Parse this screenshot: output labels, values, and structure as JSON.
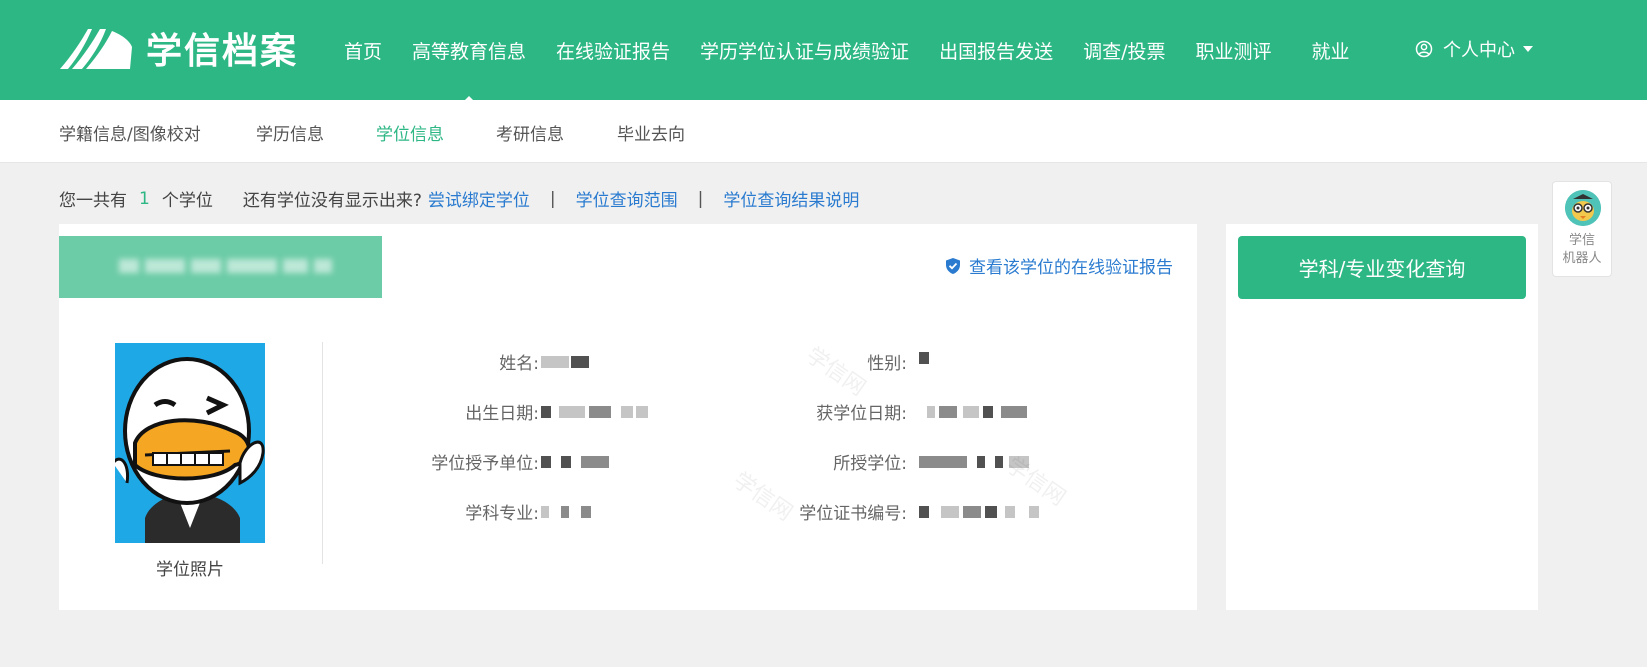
{
  "header": {
    "logo_text": "学信档案",
    "nav": [
      {
        "label": "首页"
      },
      {
        "label": "高等教育信息",
        "active": true
      },
      {
        "label": "在线验证报告"
      },
      {
        "label": "学历学位认证与成绩验证"
      },
      {
        "label": "出国报告发送"
      },
      {
        "label": "调查/投票"
      },
      {
        "label": "职业测评"
      },
      {
        "label": "就业"
      }
    ],
    "user_center": "个人中心"
  },
  "subnav": {
    "items": [
      "学籍信息/图像校对",
      "学历信息",
      "学位信息",
      "考研信息",
      "毕业去向"
    ],
    "active_index": 2
  },
  "summary": {
    "prefix": "您一共有",
    "count": "1",
    "suffix": "个学位",
    "question": "还有学位没有显示出来?",
    "links": [
      "尝试绑定学位",
      "学位查询范围",
      "学位查询结果说明"
    ],
    "separator": "|"
  },
  "degree_card": {
    "verify_link": "查看该学位的在线验证报告",
    "photo_label": "学位照片",
    "fields": [
      {
        "label": "姓名:"
      },
      {
        "label": "出生日期:"
      },
      {
        "label": "学位授予单位:"
      },
      {
        "label": "学科专业:"
      },
      {
        "label": "性别:"
      },
      {
        "label": "获学位日期:"
      },
      {
        "label": "所授学位:"
      },
      {
        "label": "学位证书编号:"
      }
    ]
  },
  "side_card": {
    "button": "学科/专业变化查询"
  },
  "robot": {
    "line1": "学信",
    "line2": "机器人"
  },
  "colors": {
    "brand": "#2db785",
    "link": "#2a7bd0"
  }
}
